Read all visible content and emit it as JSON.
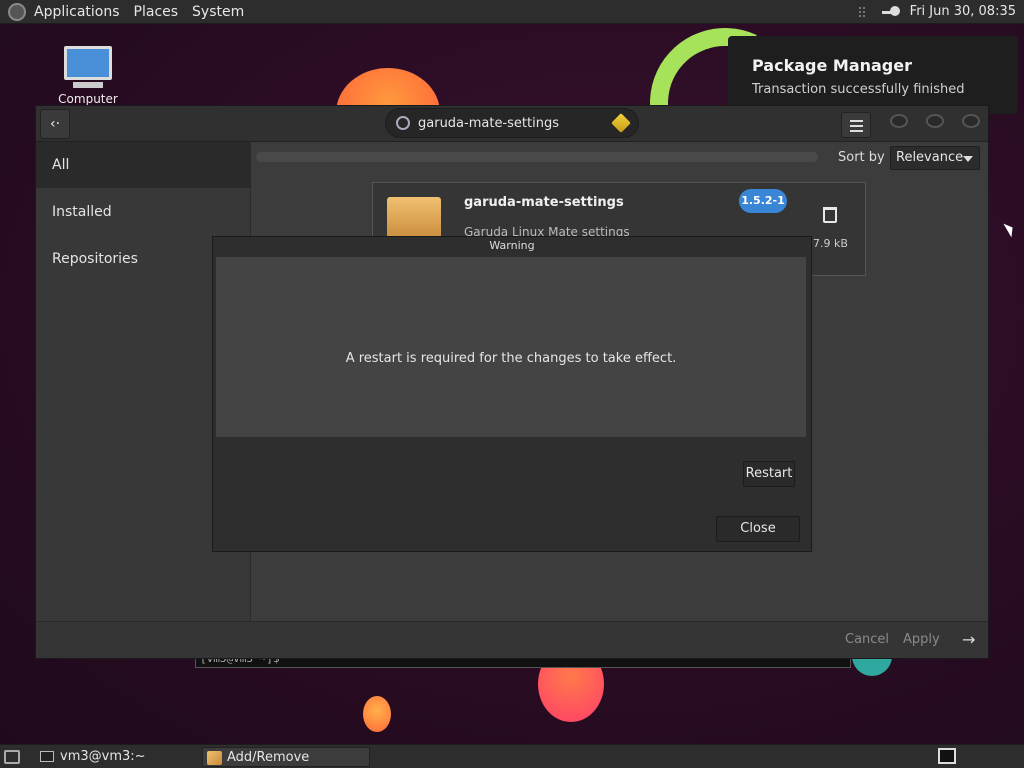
{
  "top_panel": {
    "menus": [
      "Applications",
      "Places",
      "System"
    ],
    "clock": "Fri Jun 30, 08:35"
  },
  "desktop": {
    "computer_icon_label": "Computer"
  },
  "notification": {
    "title": "Package Manager",
    "body": "Transaction successfully finished"
  },
  "terminal_strip": {
    "text": "[vm3@vm3 ~]$"
  },
  "app": {
    "search": {
      "value": "garuda-mate-settings"
    },
    "sidebar": {
      "items": [
        {
          "label": "All"
        },
        {
          "label": "Installed"
        },
        {
          "label": "Repositories"
        }
      ]
    },
    "sort": {
      "label": "Sort by",
      "value": "Relevance"
    },
    "package": {
      "name": "garuda-mate-settings",
      "description": "Garuda Linux Mate settings",
      "version": "1.5.2-1",
      "size": "7.9 kB"
    },
    "bottom": {
      "cancel": "Cancel",
      "apply": "Apply"
    }
  },
  "dialog": {
    "title": "Warning",
    "message": "A restart is required for the changes to take effect.",
    "restart_label": "Restart",
    "close_label": "Close"
  },
  "taskbar": {
    "tasks": [
      {
        "label": "vm3@vm3:~"
      },
      {
        "label": "Add/Remove Software"
      }
    ]
  }
}
